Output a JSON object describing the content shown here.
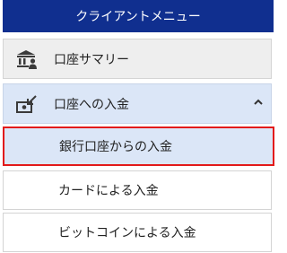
{
  "menu": {
    "title": "クライアントメニュー",
    "items": [
      {
        "label": "口座サマリー",
        "icon": "bank-user-icon"
      },
      {
        "label": "口座への入金",
        "icon": "deposit-icon",
        "expanded": true,
        "subitems": [
          {
            "label": "銀行口座からの入金",
            "selected": true
          },
          {
            "label": "カードによる入金"
          },
          {
            "label": "ビットコインによる入金"
          }
        ]
      }
    ]
  },
  "colors": {
    "header_bg": "#102f8f",
    "active_bg": "#dbe6f7",
    "highlight_border": "#e21a1a",
    "item_bg": "#eeeeee"
  }
}
